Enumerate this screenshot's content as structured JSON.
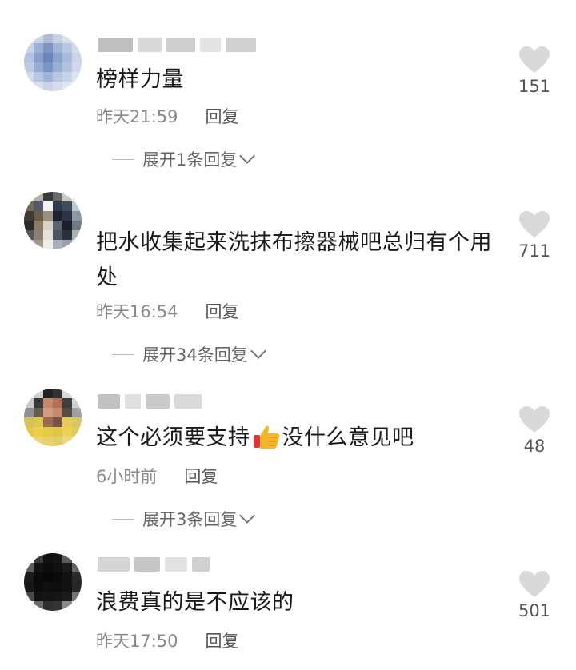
{
  "comments": [
    {
      "text": "榜样力量",
      "time": "昨天21:59",
      "reply_label": "回复",
      "expand_label": "展开1条回复",
      "likes": "151"
    },
    {
      "text": "把水收集起来洗抹布擦器械吧总归有个用处",
      "time": "昨天16:54",
      "reply_label": "回复",
      "expand_label": "展开34条回复",
      "likes": "711"
    },
    {
      "text_before": "这个必须要支持",
      "text_after": "没什么意见吧",
      "time": "6小时前",
      "reply_label": "回复",
      "expand_label": "展开3条回复",
      "likes": "48"
    },
    {
      "text": "浪费真的是不应该的",
      "time": "昨天17:50",
      "reply_label": "回复",
      "likes": "501"
    }
  ],
  "colors": {
    "heart": "#d9d9d9",
    "meta": "#8a8a8a",
    "text": "#1a1a1a"
  },
  "icons": [
    "heart-icon",
    "chevron-down-icon",
    "thumbs-up-emoji"
  ]
}
